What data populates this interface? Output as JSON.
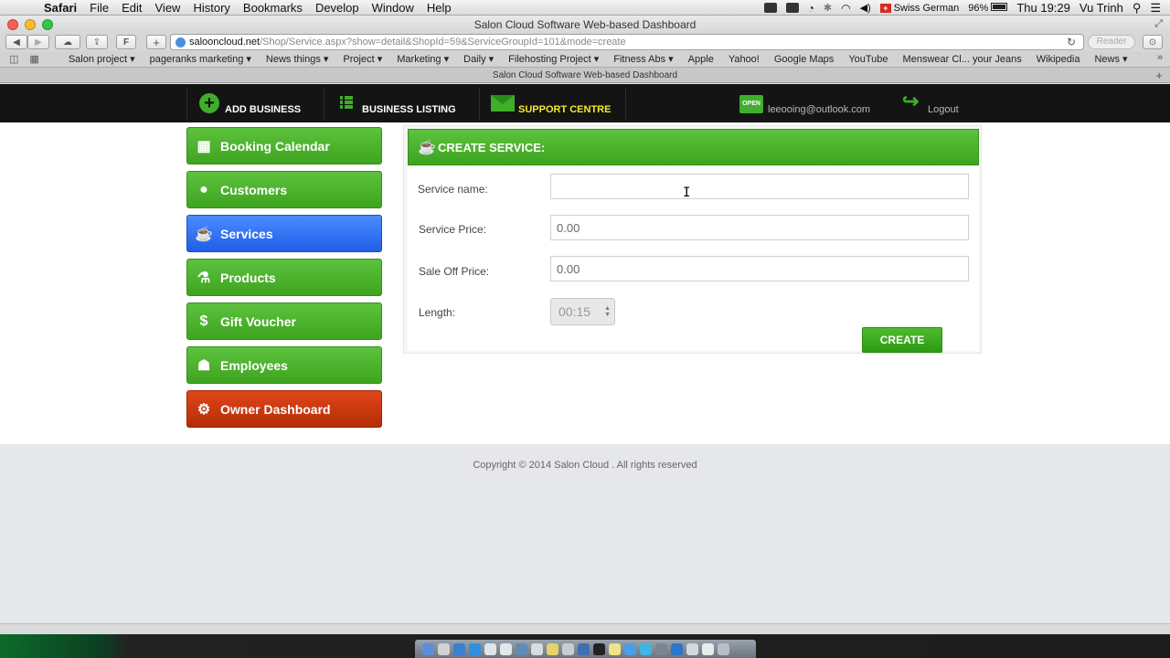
{
  "menubar": {
    "app": "Safari",
    "items": [
      "File",
      "Edit",
      "View",
      "History",
      "Bookmarks",
      "Develop",
      "Window",
      "Help"
    ],
    "keyboard": "Swiss German",
    "battery": "96%",
    "clock": "Thu 19:29",
    "user": "Vu Trinh"
  },
  "browser": {
    "window_title": "Salon Cloud Software Web-based Dashboard",
    "url_host": "salooncloud.net",
    "url_path": "/Shop/Service.aspx?show=detail&ShopId=59&ServiceGroupId=101&mode=create",
    "reader": "Reader",
    "tab_title": "Salon Cloud Software Web-based Dashboard",
    "bookmarks": [
      "Salon project ▾",
      "pageranks marketing ▾",
      "News things ▾",
      "Project ▾",
      "Marketing ▾",
      "Daily ▾",
      "Filehosting Project ▾",
      "Fitness Abs ▾",
      "Apple",
      "Yahoo!",
      "Google Maps",
      "YouTube",
      "Menswear Cl... your Jeans",
      "Wikipedia",
      "News ▾"
    ]
  },
  "topnav": {
    "add_business": "ADD BUSINESS",
    "business_listing": "BUSINESS LISTING",
    "support_centre": "SUPPORT CENTRE",
    "open_sign": "OPEN",
    "user_email": "leeooing@outlook.com",
    "logout": "Logout",
    "accent": "#3fae2a",
    "support_color": "#f5e82c"
  },
  "sidebar": {
    "items": [
      {
        "label": "Booking Calendar",
        "icon": "calendar-icon"
      },
      {
        "label": "Customers",
        "icon": "user-icon"
      },
      {
        "label": "Services",
        "icon": "cup-icon",
        "active": true
      },
      {
        "label": "Products",
        "icon": "flask-icon"
      },
      {
        "label": "Gift Voucher",
        "icon": "dollar-icon"
      },
      {
        "label": "Employees",
        "icon": "group-icon"
      },
      {
        "label": "Owner Dashboard",
        "icon": "gear-icon"
      }
    ],
    "active_color": "#2c6cf2",
    "owner_color": "#c8380d"
  },
  "form": {
    "title": "CREATE SERVICE:",
    "service_name_label": "Service name:",
    "service_name_value": "",
    "service_price_label": "Service Price:",
    "service_price_value": "0.00",
    "sale_off_label": "Sale Off Price:",
    "sale_off_value": "0.00",
    "length_label": "Length:",
    "length_value": "00:15",
    "create_button": "CREATE"
  },
  "footer": {
    "copyright": "Copyright © 2014 Salon Cloud . All rights reserved"
  }
}
